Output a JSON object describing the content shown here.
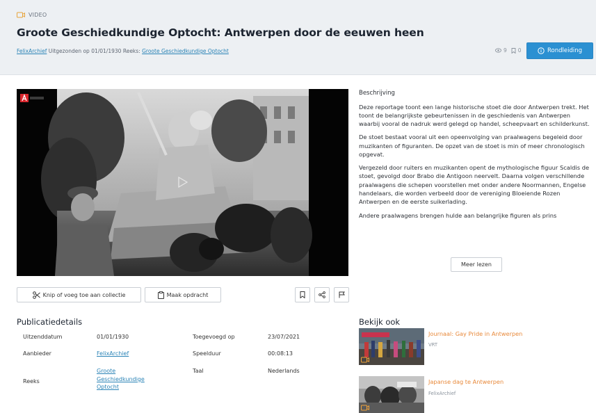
{
  "header": {
    "type_label": "VIDEO",
    "title": "Groote Geschiedkundige Optocht: Antwerpen door de eeuwen heen",
    "provider_link": "FelixArchief",
    "broadcast_text": "Uitgezonden op 01/01/1930",
    "series_prefix": "Reeks:",
    "series_link": "Groote Geschiedkundige Optocht",
    "views_count": "9",
    "saves_count": "0",
    "tour_button": "Rondleiding"
  },
  "player": {
    "logo_icon": "vrt-logo-icon",
    "play_icon": "play-icon"
  },
  "description": {
    "heading": "Beschrijving",
    "paragraphs": [
      "Deze reportage toont een lange historische stoet die door Antwerpen trekt. Het toont de belangrijkste gebeurtenissen in de geschiedenis van Antwerpen waarbij vooral de nadruk werd gelegd op handel, scheepvaart en schilderkunst.",
      "De stoet bestaat vooral uit een opeenvolging van praalwagens begeleid door muzikanten of figuranten. De opzet van de stoet is min of meer chronologisch opgevat.",
      "Vergezeld door ruiters en muzikanten opent de mythologische figuur Scaldis de stoet, gevolgd door Brabo die Antigoon neervelt. Daarna volgen verschillende praalwagens die schepen voorstellen met onder andere Noormannen, Engelse handelaars, die worden verbeeld door de vereniging Bloeiende Rozen Antwerpen en de eerste suikerlading.",
      "Andere praalwagens brengen hulde aan belangrijke figuren als prins"
    ],
    "more_button": "Meer lezen"
  },
  "actions": {
    "clip_button": "Knip of voeg toe aan collectie",
    "assignment_button": "Maak opdracht",
    "bookmark_icon": "bookmark-icon",
    "share_icon": "share-icon",
    "flag_icon": "flag-icon"
  },
  "details": {
    "heading": "Publicatiedetails",
    "broadcast_date_label": "Uitzenddatum",
    "broadcast_date_value": "01/01/1930",
    "added_label": "Toegevoegd op",
    "added_value": "23/07/2021",
    "provider_label": "Aanbieder",
    "provider_value": "FelixArchief",
    "duration_label": "Speelduur",
    "duration_value": "00:08:13",
    "series_label": "Reeks",
    "series_value_line1": "Groote",
    "series_value_line2": "Geschiedkundige",
    "series_value_line3": "Optocht",
    "language_label": "Taal",
    "language_value": "Nederlands"
  },
  "related": {
    "heading": "Bekijk ook",
    "items": [
      {
        "title": "Journaal: Gay Pride in Antwerpen",
        "source": "VRT"
      },
      {
        "title": "Japanse dag te Antwerpen",
        "source": "FelixArchief"
      }
    ]
  },
  "colors": {
    "accent_blue": "#2b90d2",
    "link_blue": "#2a83b6",
    "related_orange": "#e8893a",
    "header_bg": "#edf0f3"
  }
}
